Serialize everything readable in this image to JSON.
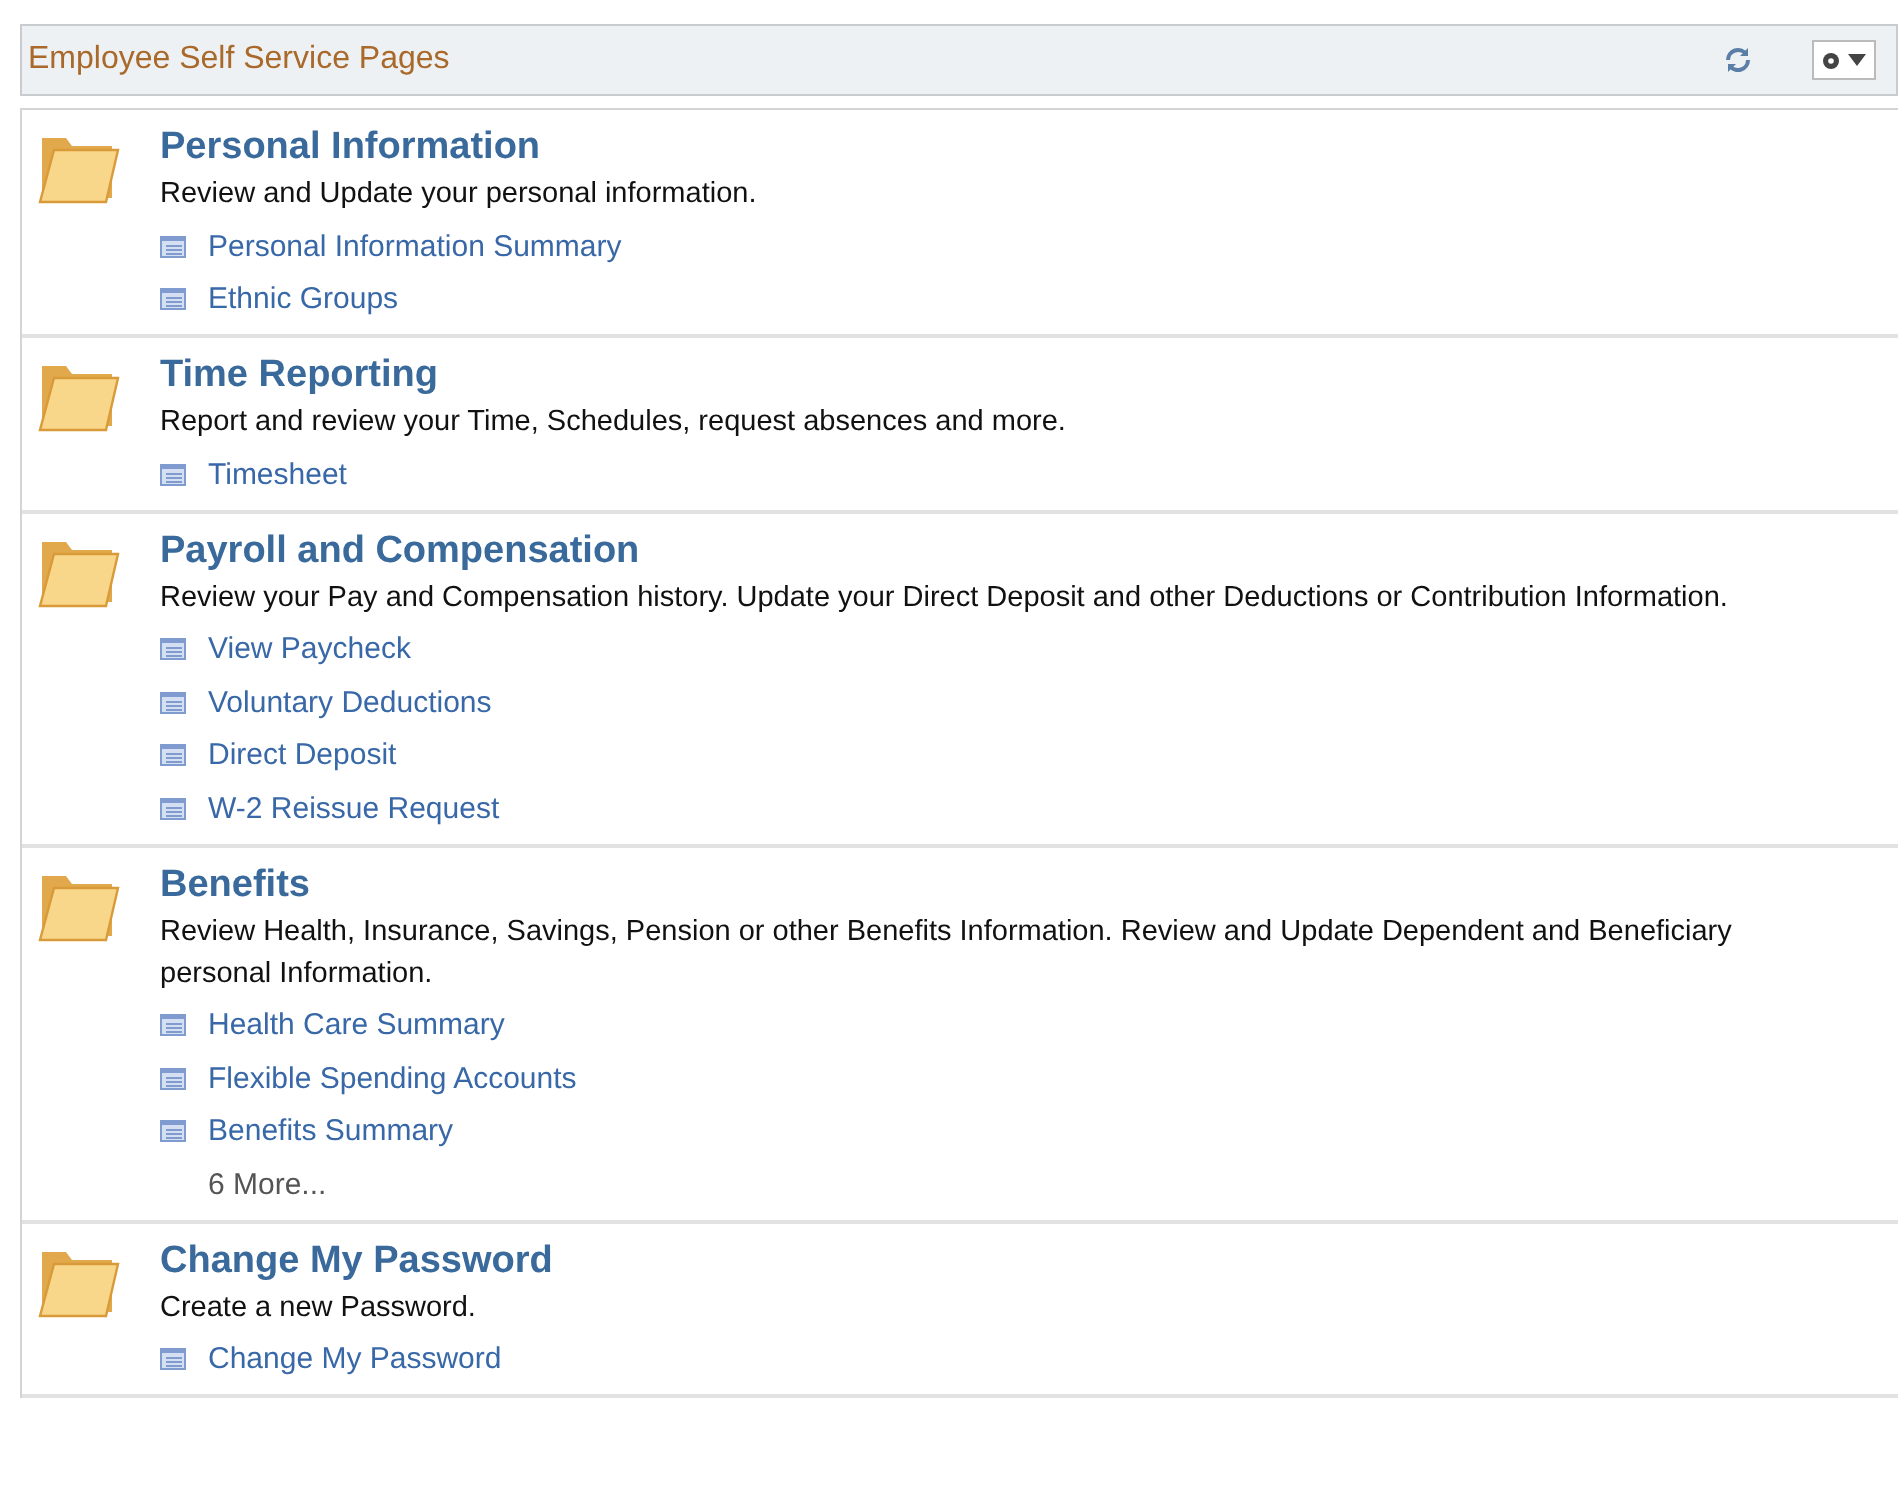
{
  "header": {
    "title": "Employee Self Service Pages"
  },
  "sections": [
    {
      "title": "Personal Information",
      "description": "Review and Update your personal information.",
      "links": [
        {
          "kind": "page",
          "label": "Personal Information Summary"
        },
        {
          "kind": "page",
          "label": "Ethnic Groups"
        }
      ]
    },
    {
      "title": "Time Reporting",
      "description": "Report and review your Time, Schedules, request absences and more.",
      "links": [
        {
          "kind": "page",
          "label": "Timesheet"
        }
      ]
    },
    {
      "title": "Payroll and Compensation",
      "description": "Review your Pay and Compensation history. Update your Direct Deposit and other Deductions or Contribution Information.",
      "links": [
        {
          "kind": "page",
          "label": "View Paycheck"
        },
        {
          "kind": "page",
          "label": "Voluntary Deductions"
        },
        {
          "kind": "page",
          "label": "Direct Deposit"
        },
        {
          "kind": "page",
          "label": "W-2 Reissue Request"
        }
      ]
    },
    {
      "title": "Benefits",
      "description": "Review Health, Insurance, Savings, Pension or other Benefits Information. Review and Update Dependent and Beneficiary personal Information.",
      "links": [
        {
          "kind": "page",
          "label": "Health Care Summary"
        },
        {
          "kind": "page",
          "label": "Flexible Spending Accounts"
        },
        {
          "kind": "page",
          "label": "Benefits Summary"
        },
        {
          "kind": "more",
          "label": "6 More..."
        }
      ]
    },
    {
      "title": "Change My Password",
      "description": "Create a new Password.",
      "links": [
        {
          "kind": "page",
          "label": "Change My Password"
        }
      ]
    }
  ]
}
